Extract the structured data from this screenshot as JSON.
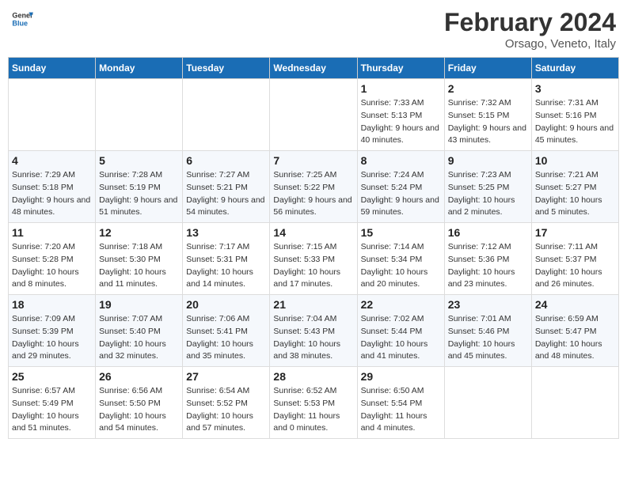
{
  "header": {
    "logo_line1": "General",
    "logo_line2": "Blue",
    "main_title": "February 2024",
    "subtitle": "Orsago, Veneto, Italy"
  },
  "days_of_week": [
    "Sunday",
    "Monday",
    "Tuesday",
    "Wednesday",
    "Thursday",
    "Friday",
    "Saturday"
  ],
  "weeks": [
    [
      {
        "day": "",
        "sunrise": "",
        "sunset": "",
        "daylight": ""
      },
      {
        "day": "",
        "sunrise": "",
        "sunset": "",
        "daylight": ""
      },
      {
        "day": "",
        "sunrise": "",
        "sunset": "",
        "daylight": ""
      },
      {
        "day": "",
        "sunrise": "",
        "sunset": "",
        "daylight": ""
      },
      {
        "day": "1",
        "sunrise": "Sunrise: 7:33 AM",
        "sunset": "Sunset: 5:13 PM",
        "daylight": "Daylight: 9 hours and 40 minutes."
      },
      {
        "day": "2",
        "sunrise": "Sunrise: 7:32 AM",
        "sunset": "Sunset: 5:15 PM",
        "daylight": "Daylight: 9 hours and 43 minutes."
      },
      {
        "day": "3",
        "sunrise": "Sunrise: 7:31 AM",
        "sunset": "Sunset: 5:16 PM",
        "daylight": "Daylight: 9 hours and 45 minutes."
      }
    ],
    [
      {
        "day": "4",
        "sunrise": "Sunrise: 7:29 AM",
        "sunset": "Sunset: 5:18 PM",
        "daylight": "Daylight: 9 hours and 48 minutes."
      },
      {
        "day": "5",
        "sunrise": "Sunrise: 7:28 AM",
        "sunset": "Sunset: 5:19 PM",
        "daylight": "Daylight: 9 hours and 51 minutes."
      },
      {
        "day": "6",
        "sunrise": "Sunrise: 7:27 AM",
        "sunset": "Sunset: 5:21 PM",
        "daylight": "Daylight: 9 hours and 54 minutes."
      },
      {
        "day": "7",
        "sunrise": "Sunrise: 7:25 AM",
        "sunset": "Sunset: 5:22 PM",
        "daylight": "Daylight: 9 hours and 56 minutes."
      },
      {
        "day": "8",
        "sunrise": "Sunrise: 7:24 AM",
        "sunset": "Sunset: 5:24 PM",
        "daylight": "Daylight: 9 hours and 59 minutes."
      },
      {
        "day": "9",
        "sunrise": "Sunrise: 7:23 AM",
        "sunset": "Sunset: 5:25 PM",
        "daylight": "Daylight: 10 hours and 2 minutes."
      },
      {
        "day": "10",
        "sunrise": "Sunrise: 7:21 AM",
        "sunset": "Sunset: 5:27 PM",
        "daylight": "Daylight: 10 hours and 5 minutes."
      }
    ],
    [
      {
        "day": "11",
        "sunrise": "Sunrise: 7:20 AM",
        "sunset": "Sunset: 5:28 PM",
        "daylight": "Daylight: 10 hours and 8 minutes."
      },
      {
        "day": "12",
        "sunrise": "Sunrise: 7:18 AM",
        "sunset": "Sunset: 5:30 PM",
        "daylight": "Daylight: 10 hours and 11 minutes."
      },
      {
        "day": "13",
        "sunrise": "Sunrise: 7:17 AM",
        "sunset": "Sunset: 5:31 PM",
        "daylight": "Daylight: 10 hours and 14 minutes."
      },
      {
        "day": "14",
        "sunrise": "Sunrise: 7:15 AM",
        "sunset": "Sunset: 5:33 PM",
        "daylight": "Daylight: 10 hours and 17 minutes."
      },
      {
        "day": "15",
        "sunrise": "Sunrise: 7:14 AM",
        "sunset": "Sunset: 5:34 PM",
        "daylight": "Daylight: 10 hours and 20 minutes."
      },
      {
        "day": "16",
        "sunrise": "Sunrise: 7:12 AM",
        "sunset": "Sunset: 5:36 PM",
        "daylight": "Daylight: 10 hours and 23 minutes."
      },
      {
        "day": "17",
        "sunrise": "Sunrise: 7:11 AM",
        "sunset": "Sunset: 5:37 PM",
        "daylight": "Daylight: 10 hours and 26 minutes."
      }
    ],
    [
      {
        "day": "18",
        "sunrise": "Sunrise: 7:09 AM",
        "sunset": "Sunset: 5:39 PM",
        "daylight": "Daylight: 10 hours and 29 minutes."
      },
      {
        "day": "19",
        "sunrise": "Sunrise: 7:07 AM",
        "sunset": "Sunset: 5:40 PM",
        "daylight": "Daylight: 10 hours and 32 minutes."
      },
      {
        "day": "20",
        "sunrise": "Sunrise: 7:06 AM",
        "sunset": "Sunset: 5:41 PM",
        "daylight": "Daylight: 10 hours and 35 minutes."
      },
      {
        "day": "21",
        "sunrise": "Sunrise: 7:04 AM",
        "sunset": "Sunset: 5:43 PM",
        "daylight": "Daylight: 10 hours and 38 minutes."
      },
      {
        "day": "22",
        "sunrise": "Sunrise: 7:02 AM",
        "sunset": "Sunset: 5:44 PM",
        "daylight": "Daylight: 10 hours and 41 minutes."
      },
      {
        "day": "23",
        "sunrise": "Sunrise: 7:01 AM",
        "sunset": "Sunset: 5:46 PM",
        "daylight": "Daylight: 10 hours and 45 minutes."
      },
      {
        "day": "24",
        "sunrise": "Sunrise: 6:59 AM",
        "sunset": "Sunset: 5:47 PM",
        "daylight": "Daylight: 10 hours and 48 minutes."
      }
    ],
    [
      {
        "day": "25",
        "sunrise": "Sunrise: 6:57 AM",
        "sunset": "Sunset: 5:49 PM",
        "daylight": "Daylight: 10 hours and 51 minutes."
      },
      {
        "day": "26",
        "sunrise": "Sunrise: 6:56 AM",
        "sunset": "Sunset: 5:50 PM",
        "daylight": "Daylight: 10 hours and 54 minutes."
      },
      {
        "day": "27",
        "sunrise": "Sunrise: 6:54 AM",
        "sunset": "Sunset: 5:52 PM",
        "daylight": "Daylight: 10 hours and 57 minutes."
      },
      {
        "day": "28",
        "sunrise": "Sunrise: 6:52 AM",
        "sunset": "Sunset: 5:53 PM",
        "daylight": "Daylight: 11 hours and 0 minutes."
      },
      {
        "day": "29",
        "sunrise": "Sunrise: 6:50 AM",
        "sunset": "Sunset: 5:54 PM",
        "daylight": "Daylight: 11 hours and 4 minutes."
      },
      {
        "day": "",
        "sunrise": "",
        "sunset": "",
        "daylight": ""
      },
      {
        "day": "",
        "sunrise": "",
        "sunset": "",
        "daylight": ""
      }
    ]
  ]
}
